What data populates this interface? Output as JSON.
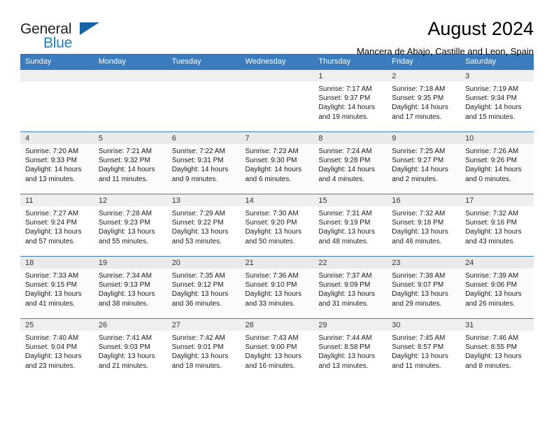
{
  "brand": {
    "name_top": "General",
    "name_bottom": "Blue",
    "triangle_color": "#1464a5",
    "blue_color": "#1b7fc4"
  },
  "header": {
    "title": "August 2024",
    "subtitle": "Mancera de Abajo, Castille and Leon, Spain"
  },
  "theme": {
    "header_bg": "#3b7cbf",
    "daynum_bg": "#efefef",
    "row_alt_bg": "#fbfbfb"
  },
  "calendar": {
    "weekday_headers": [
      "Sunday",
      "Monday",
      "Tuesday",
      "Wednesday",
      "Thursday",
      "Friday",
      "Saturday"
    ],
    "weeks": [
      [
        {
          "day": "",
          "empty": true,
          "sunrise": "",
          "sunset": "",
          "daylight": ""
        },
        {
          "day": "",
          "empty": true,
          "sunrise": "",
          "sunset": "",
          "daylight": ""
        },
        {
          "day": "",
          "empty": true,
          "sunrise": "",
          "sunset": "",
          "daylight": ""
        },
        {
          "day": "",
          "empty": true,
          "sunrise": "",
          "sunset": "",
          "daylight": ""
        },
        {
          "day": "1",
          "sunrise": "Sunrise: 7:17 AM",
          "sunset": "Sunset: 9:37 PM",
          "daylight": "Daylight: 14 hours and 19 minutes."
        },
        {
          "day": "2",
          "sunrise": "Sunrise: 7:18 AM",
          "sunset": "Sunset: 9:35 PM",
          "daylight": "Daylight: 14 hours and 17 minutes."
        },
        {
          "day": "3",
          "sunrise": "Sunrise: 7:19 AM",
          "sunset": "Sunset: 9:34 PM",
          "daylight": "Daylight: 14 hours and 15 minutes."
        }
      ],
      [
        {
          "day": "4",
          "sunrise": "Sunrise: 7:20 AM",
          "sunset": "Sunset: 9:33 PM",
          "daylight": "Daylight: 14 hours and 13 minutes."
        },
        {
          "day": "5",
          "sunrise": "Sunrise: 7:21 AM",
          "sunset": "Sunset: 9:32 PM",
          "daylight": "Daylight: 14 hours and 11 minutes."
        },
        {
          "day": "6",
          "sunrise": "Sunrise: 7:22 AM",
          "sunset": "Sunset: 9:31 PM",
          "daylight": "Daylight: 14 hours and 9 minutes."
        },
        {
          "day": "7",
          "sunrise": "Sunrise: 7:23 AM",
          "sunset": "Sunset: 9:30 PM",
          "daylight": "Daylight: 14 hours and 6 minutes."
        },
        {
          "day": "8",
          "sunrise": "Sunrise: 7:24 AM",
          "sunset": "Sunset: 9:28 PM",
          "daylight": "Daylight: 14 hours and 4 minutes."
        },
        {
          "day": "9",
          "sunrise": "Sunrise: 7:25 AM",
          "sunset": "Sunset: 9:27 PM",
          "daylight": "Daylight: 14 hours and 2 minutes."
        },
        {
          "day": "10",
          "sunrise": "Sunrise: 7:26 AM",
          "sunset": "Sunset: 9:26 PM",
          "daylight": "Daylight: 14 hours and 0 minutes."
        }
      ],
      [
        {
          "day": "11",
          "sunrise": "Sunrise: 7:27 AM",
          "sunset": "Sunset: 9:24 PM",
          "daylight": "Daylight: 13 hours and 57 minutes."
        },
        {
          "day": "12",
          "sunrise": "Sunrise: 7:28 AM",
          "sunset": "Sunset: 9:23 PM",
          "daylight": "Daylight: 13 hours and 55 minutes."
        },
        {
          "day": "13",
          "sunrise": "Sunrise: 7:29 AM",
          "sunset": "Sunset: 9:22 PM",
          "daylight": "Daylight: 13 hours and 53 minutes."
        },
        {
          "day": "14",
          "sunrise": "Sunrise: 7:30 AM",
          "sunset": "Sunset: 9:20 PM",
          "daylight": "Daylight: 13 hours and 50 minutes."
        },
        {
          "day": "15",
          "sunrise": "Sunrise: 7:31 AM",
          "sunset": "Sunset: 9:19 PM",
          "daylight": "Daylight: 13 hours and 48 minutes."
        },
        {
          "day": "16",
          "sunrise": "Sunrise: 7:32 AM",
          "sunset": "Sunset: 9:18 PM",
          "daylight": "Daylight: 13 hours and 46 minutes."
        },
        {
          "day": "17",
          "sunrise": "Sunrise: 7:32 AM",
          "sunset": "Sunset: 9:16 PM",
          "daylight": "Daylight: 13 hours and 43 minutes."
        }
      ],
      [
        {
          "day": "18",
          "sunrise": "Sunrise: 7:33 AM",
          "sunset": "Sunset: 9:15 PM",
          "daylight": "Daylight: 13 hours and 41 minutes."
        },
        {
          "day": "19",
          "sunrise": "Sunrise: 7:34 AM",
          "sunset": "Sunset: 9:13 PM",
          "daylight": "Daylight: 13 hours and 38 minutes."
        },
        {
          "day": "20",
          "sunrise": "Sunrise: 7:35 AM",
          "sunset": "Sunset: 9:12 PM",
          "daylight": "Daylight: 13 hours and 36 minutes."
        },
        {
          "day": "21",
          "sunrise": "Sunrise: 7:36 AM",
          "sunset": "Sunset: 9:10 PM",
          "daylight": "Daylight: 13 hours and 33 minutes."
        },
        {
          "day": "22",
          "sunrise": "Sunrise: 7:37 AM",
          "sunset": "Sunset: 9:09 PM",
          "daylight": "Daylight: 13 hours and 31 minutes."
        },
        {
          "day": "23",
          "sunrise": "Sunrise: 7:38 AM",
          "sunset": "Sunset: 9:07 PM",
          "daylight": "Daylight: 13 hours and 29 minutes."
        },
        {
          "day": "24",
          "sunrise": "Sunrise: 7:39 AM",
          "sunset": "Sunset: 9:06 PM",
          "daylight": "Daylight: 13 hours and 26 minutes."
        }
      ],
      [
        {
          "day": "25",
          "sunrise": "Sunrise: 7:40 AM",
          "sunset": "Sunset: 9:04 PM",
          "daylight": "Daylight: 13 hours and 23 minutes."
        },
        {
          "day": "26",
          "sunrise": "Sunrise: 7:41 AM",
          "sunset": "Sunset: 9:03 PM",
          "daylight": "Daylight: 13 hours and 21 minutes."
        },
        {
          "day": "27",
          "sunrise": "Sunrise: 7:42 AM",
          "sunset": "Sunset: 9:01 PM",
          "daylight": "Daylight: 13 hours and 18 minutes."
        },
        {
          "day": "28",
          "sunrise": "Sunrise: 7:43 AM",
          "sunset": "Sunset: 9:00 PM",
          "daylight": "Daylight: 13 hours and 16 minutes."
        },
        {
          "day": "29",
          "sunrise": "Sunrise: 7:44 AM",
          "sunset": "Sunset: 8:58 PM",
          "daylight": "Daylight: 13 hours and 13 minutes."
        },
        {
          "day": "30",
          "sunrise": "Sunrise: 7:45 AM",
          "sunset": "Sunset: 8:57 PM",
          "daylight": "Daylight: 13 hours and 11 minutes."
        },
        {
          "day": "31",
          "sunrise": "Sunrise: 7:46 AM",
          "sunset": "Sunset: 8:55 PM",
          "daylight": "Daylight: 13 hours and 8 minutes."
        }
      ]
    ]
  }
}
